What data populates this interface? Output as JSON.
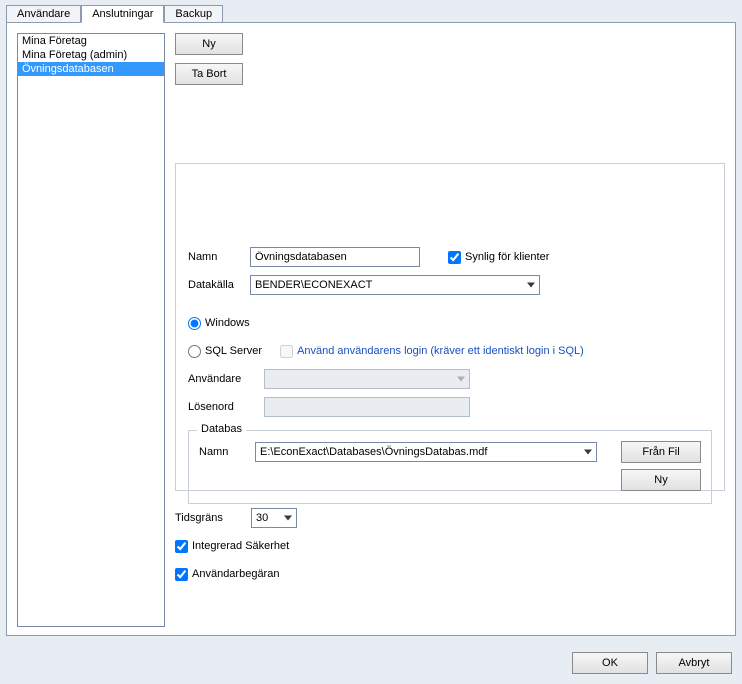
{
  "tabs": {
    "users": "Användare",
    "connections": "Anslutningar",
    "backup": "Backup"
  },
  "list": {
    "items": [
      "Mina Företag",
      "Mina Företag (admin)",
      "Övningsdatabasen"
    ],
    "selected_index": 2
  },
  "buttons": {
    "new": "Ny",
    "delete": "Ta Bort",
    "from_file": "Från Fil",
    "ok": "OK",
    "cancel": "Avbryt"
  },
  "labels": {
    "name": "Namn",
    "datasource": "Datakälla",
    "visible_to_clients": "Synlig för klienter",
    "windows": "Windows",
    "sqlserver": "SQL Server",
    "use_user_login": "Använd användarens login (kräver ett identiskt login i SQL)",
    "user": "Användare",
    "password": "Lösenord",
    "database": "Databas",
    "timeout": "Tidsgräns",
    "integrated_security": "Integrerad Säkerhet",
    "user_request": "Användarbegäran"
  },
  "values": {
    "name": "Övningsdatabasen",
    "datasource": "BENDER\\ECONEXACT",
    "visible_to_clients": true,
    "auth_mode": "windows",
    "use_user_login": false,
    "user": "",
    "password": "",
    "database_path": "E:\\EconExact\\Databases\\ÖvningsDatabas.mdf",
    "timeout": "30",
    "integrated_security": true,
    "user_request": true
  }
}
